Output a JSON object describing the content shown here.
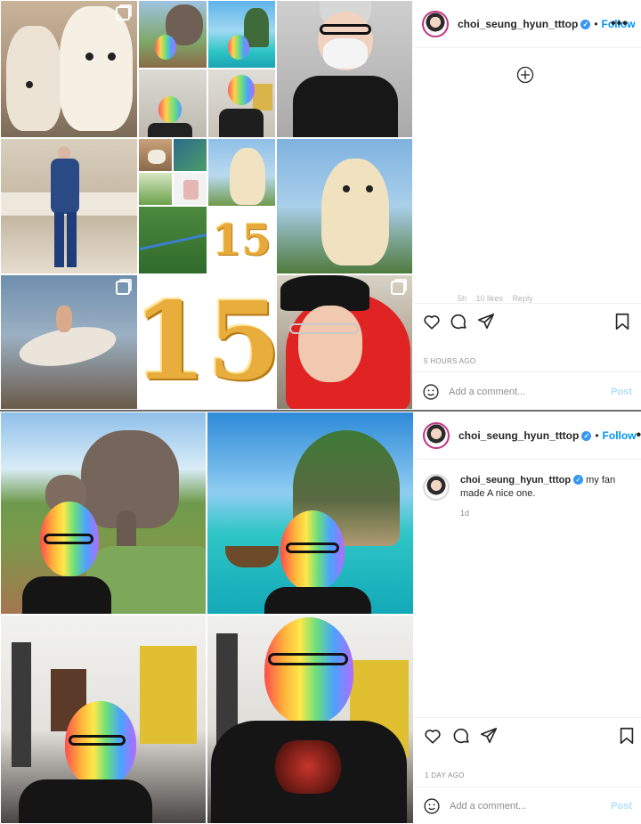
{
  "post1": {
    "username": "choi_seung_hyun_tttop",
    "follow_label": "Follow",
    "separator": "•",
    "more_label": "•••",
    "add_icon": "plus-circle-icon",
    "faded_meta": [
      "5h",
      "10 likes",
      "Reply"
    ],
    "timestamp": "5 HOURS AGO",
    "comment_placeholder": "Add a comment...",
    "post_label": "Post",
    "grid_digits": [
      "15",
      "15"
    ]
  },
  "post2": {
    "username": "choi_seung_hyun_tttop",
    "follow_label": "Follow",
    "separator": "•",
    "more_label": "•••",
    "caption_user": "choi_seung_hyun_tttop",
    "caption_text": "my fan made A nice one.",
    "caption_age": "1d",
    "timestamp": "1 DAY AGO",
    "comment_placeholder": "Add a comment...",
    "post_label": "Post"
  },
  "icons": [
    "heart-icon",
    "comment-icon",
    "share-icon",
    "bookmark-icon",
    "emoji-icon",
    "verified-badge-icon",
    "multi-photo-icon"
  ],
  "colors": {
    "link_blue": "#0095f6",
    "verified_blue": "#3897f0",
    "muted_gray": "#8e8e8e"
  }
}
